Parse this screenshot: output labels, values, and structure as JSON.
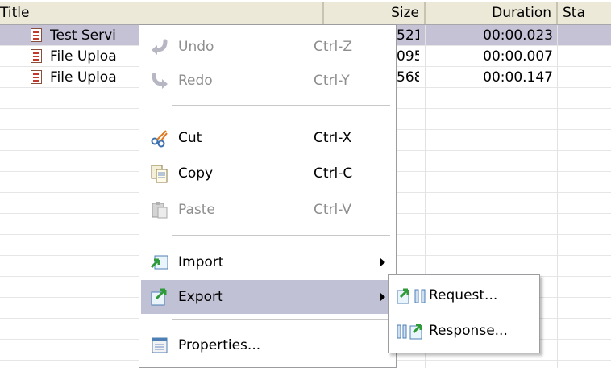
{
  "table": {
    "columns": [
      "Title",
      "Size",
      "Duration",
      "Sta"
    ],
    "rows": [
      {
        "title": "Test Servi",
        "size": "521",
        "duration": "00:00.023",
        "status": ""
      },
      {
        "title": "File Uploa",
        "size": "095",
        "duration": "00:00.007",
        "status": ""
      },
      {
        "title": "File Uploa",
        "size": "568",
        "duration": "00:00.147",
        "status": ""
      }
    ]
  },
  "context_menu": {
    "items": [
      {
        "label": "Undo",
        "shortcut": "Ctrl-Z",
        "icon": "undo-icon",
        "enabled": false
      },
      {
        "label": "Redo",
        "shortcut": "Ctrl-Y",
        "icon": "redo-icon",
        "enabled": false
      },
      {
        "label": "Cut",
        "shortcut": "Ctrl-X",
        "icon": "scissors-icon",
        "enabled": true
      },
      {
        "label": "Copy",
        "shortcut": "Ctrl-C",
        "icon": "copy-icon",
        "enabled": true
      },
      {
        "label": "Paste",
        "shortcut": "Ctrl-V",
        "icon": "paste-icon",
        "enabled": false
      },
      {
        "label": "Import",
        "shortcut": "",
        "icon": "import-icon",
        "enabled": true,
        "submenu": true
      },
      {
        "label": "Export",
        "shortcut": "",
        "icon": "export-icon",
        "enabled": true,
        "submenu": true,
        "highlighted": true
      },
      {
        "label": "Properties...",
        "shortcut": "",
        "icon": "properties-icon",
        "enabled": true
      }
    ]
  },
  "export_submenu": {
    "items": [
      {
        "label": "Request...",
        "icon": "export-request-icon"
      },
      {
        "label": "Response...",
        "icon": "export-response-icon"
      }
    ]
  },
  "colors": {
    "selected_row": "#c5c2d6",
    "menu_highlight": "#c1c1d6",
    "header_bg": "#ece9d8",
    "disabled_text": "#8e8e8e"
  }
}
